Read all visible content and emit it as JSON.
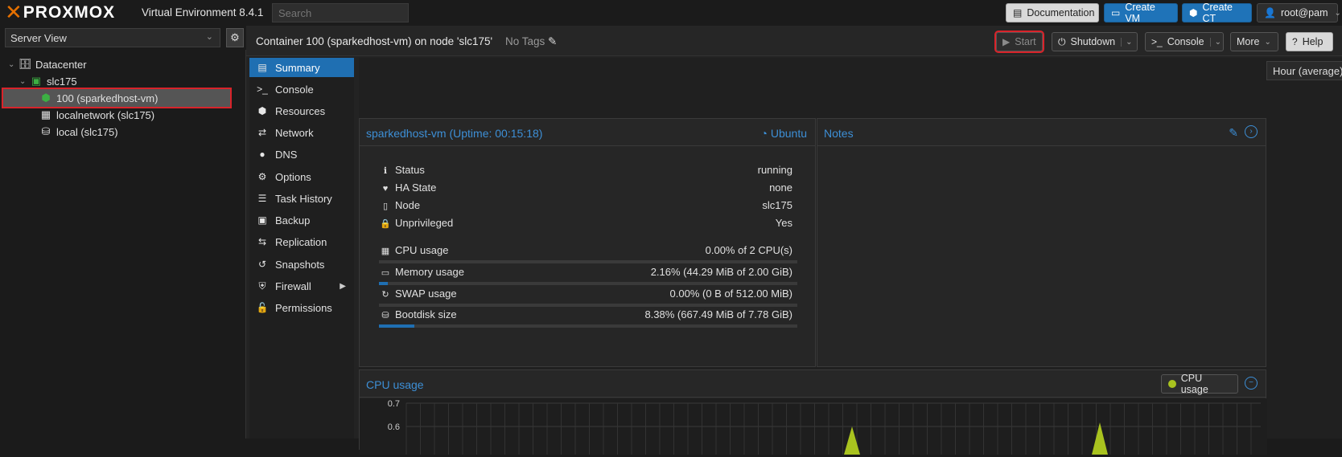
{
  "header": {
    "brand": "PROXMOX",
    "version": "Virtual Environment 8.4.1",
    "search_placeholder": "Search",
    "documentation": "Documentation",
    "create_vm": "Create VM",
    "create_ct": "Create CT",
    "user": "root@pam"
  },
  "sidebar": {
    "view": "Server View",
    "tree": [
      {
        "label": "Datacenter",
        "icon": "datacenter-icon"
      },
      {
        "label": "slc175",
        "icon": "node-online-icon"
      },
      {
        "label": "100 (sparkedhost-vm)",
        "icon": "container-running-icon"
      },
      {
        "label": "localnetwork (slc175)",
        "icon": "network-grid-icon"
      },
      {
        "label": "local (slc175)",
        "icon": "storage-icon"
      }
    ]
  },
  "toolbar": {
    "title": "Container 100 (sparkedhost-vm) on node 'slc175'",
    "tags": "No Tags",
    "start": "Start",
    "shutdown": "Shutdown",
    "console": "Console",
    "more": "More",
    "help": "Help"
  },
  "nav": [
    {
      "label": "Summary",
      "icon": "summary-icon",
      "active": true
    },
    {
      "label": "Console",
      "icon": "terminal-icon"
    },
    {
      "label": "Resources",
      "icon": "cube-icon"
    },
    {
      "label": "Network",
      "icon": "exchange-icon"
    },
    {
      "label": "DNS",
      "icon": "globe-icon"
    },
    {
      "label": "Options",
      "icon": "gear-icon"
    },
    {
      "label": "Task History",
      "icon": "list-icon"
    },
    {
      "label": "Backup",
      "icon": "floppy-icon"
    },
    {
      "label": "Replication",
      "icon": "retweet-icon"
    },
    {
      "label": "Snapshots",
      "icon": "history-icon"
    },
    {
      "label": "Firewall",
      "icon": "shield-icon"
    },
    {
      "label": "Permissions",
      "icon": "unlock-icon"
    }
  ],
  "summary": {
    "range": "Hour (average)",
    "status_title": "sparkedhost-vm (Uptime: 00:15:18)",
    "os": "Ubuntu",
    "rows": [
      {
        "label": "Status",
        "value": "running",
        "icon": "info-icon"
      },
      {
        "label": "HA State",
        "value": "none",
        "icon": "heartbeat-icon"
      },
      {
        "label": "Node",
        "value": "slc175",
        "icon": "building-icon"
      },
      {
        "label": "Unprivileged",
        "value": "Yes",
        "icon": "lock-icon"
      }
    ],
    "usage": [
      {
        "label": "CPU usage",
        "value": "0.00% of 2 CPU(s)",
        "fraction": 0.0,
        "icon": "cpu-icon"
      },
      {
        "label": "Memory usage",
        "value": "2.16% (44.29 MiB of 2.00 GiB)",
        "fraction": 0.0216,
        "icon": "memory-icon"
      },
      {
        "label": "SWAP usage",
        "value": "0.00% (0 B of 512.00 MiB)",
        "fraction": 0.0,
        "icon": "refresh-icon"
      },
      {
        "label": "Bootdisk size",
        "value": "8.38% (667.49 MiB of 7.78 GiB)",
        "fraction": 0.0838,
        "icon": "hdd-icon"
      }
    ],
    "notes_title": "Notes",
    "cpu_chart": {
      "title": "CPU usage",
      "legend": "CPU usage",
      "y_ticks": [
        "0.7",
        "0.6"
      ]
    }
  }
}
